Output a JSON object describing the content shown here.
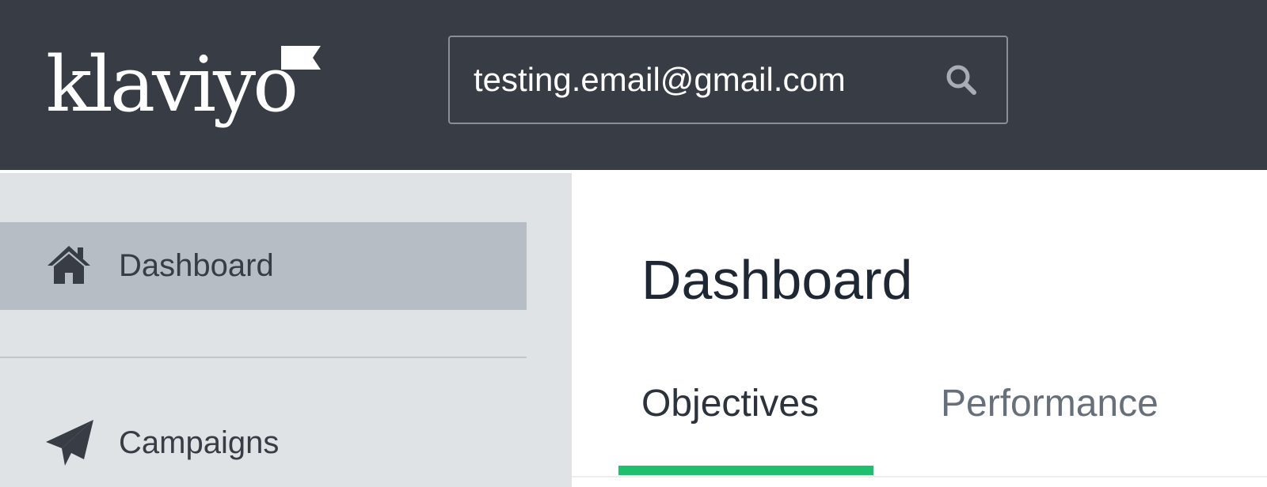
{
  "header": {
    "logo_text": "klaviyo",
    "search": {
      "value": "testing.email@gmail.com",
      "icon": "search-icon"
    },
    "colors": {
      "background": "#373c45",
      "text": "#ffffff"
    }
  },
  "sidebar": {
    "items": [
      {
        "label": "Dashboard",
        "icon": "home-icon",
        "active": true
      },
      {
        "label": "Campaigns",
        "icon": "paper-plane-icon",
        "active": false
      }
    ],
    "colors": {
      "background": "#e0e3e6",
      "active_background": "#b7bdc4"
    }
  },
  "main": {
    "title": "Dashboard",
    "tabs": [
      {
        "label": "Objectives",
        "active": true
      },
      {
        "label": "Performance",
        "active": false
      }
    ],
    "colors": {
      "accent": "#1ec06d"
    }
  }
}
